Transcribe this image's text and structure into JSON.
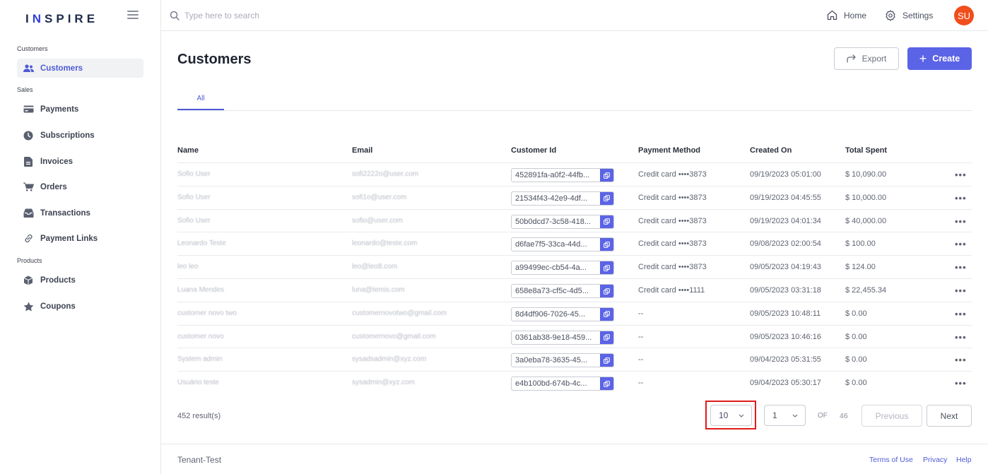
{
  "brand": {
    "name_start": "I",
    "name_accent": "N",
    "name_end": "SPIRE"
  },
  "search": {
    "placeholder": "Type here to search"
  },
  "topbar": {
    "home_label": "Home",
    "settings_label": "Settings",
    "avatar_initials": "SU"
  },
  "sidebar": {
    "sections": [
      "Customers",
      "Sales",
      "Products"
    ],
    "items": [
      {
        "label": "Customers",
        "icon": "users-icon",
        "active": true
      },
      {
        "label": "Payments",
        "icon": "credit-card-icon"
      },
      {
        "label": "Subscriptions",
        "icon": "clock-icon"
      },
      {
        "label": "Invoices",
        "icon": "document-icon"
      },
      {
        "label": "Orders",
        "icon": "cart-icon"
      },
      {
        "label": "Transactions",
        "icon": "inbox-icon"
      },
      {
        "label": "Payment Links",
        "icon": "link-icon"
      },
      {
        "label": "Products",
        "icon": "cube-icon"
      },
      {
        "label": "Coupons",
        "icon": "star-icon"
      }
    ]
  },
  "page": {
    "title": "Customers",
    "export_label": "Export",
    "create_label": "Create",
    "tab_all": "All"
  },
  "table": {
    "headers": [
      "Name",
      "Email",
      "Customer Id",
      "Payment Method",
      "Created On",
      "Total Spent"
    ],
    "rows": [
      {
        "name": "Sofio User",
        "email": "sofi2222o@user.com",
        "id": "452891fa-a0f2-44fb...",
        "method": "Credit card ••••3873",
        "created": "09/19/2023 05:01:00",
        "spent": "$ 10,090.00"
      },
      {
        "name": "Sofio User",
        "email": "sofi1o@user.com",
        "id": "21534f43-42e9-4df...",
        "method": "Credit card ••••3873",
        "created": "09/19/2023 04:45:55",
        "spent": "$ 10,000.00"
      },
      {
        "name": "Sofio User",
        "email": "sofio@user.com",
        "id": "50b0dcd7-3c58-418...",
        "method": "Credit card ••••3873",
        "created": "09/19/2023 04:01:34",
        "spent": "$ 40,000.00"
      },
      {
        "name": "Leonardo Teste",
        "email": "leonardo@teste.com",
        "id": "d6fae7f5-33ca-44d...",
        "method": "Credit card ••••3873",
        "created": "09/08/2023 02:00:54",
        "spent": "$ 100.00"
      },
      {
        "name": "leo leo",
        "email": "leo@leo8.com",
        "id": "a99499ec-cb54-4a...",
        "method": "Credit card ••••3873",
        "created": "09/05/2023 04:19:43",
        "spent": "$ 124.00"
      },
      {
        "name": "Luana Mendes",
        "email": "luna@temis.com",
        "id": "658e8a73-cf5c-4d5...",
        "method": "Credit card ••••1111",
        "created": "09/05/2023 03:31:18",
        "spent": "$ 22,455.34"
      },
      {
        "name": "customer novo two",
        "email": "customernovotwo@gmail.com",
        "id": "8d4df906-7026-45...",
        "method": "--",
        "created": "09/05/2023 10:48:11",
        "spent": "$ 0.00"
      },
      {
        "name": "customer novo",
        "email": "customernovo@gmail.com",
        "id": "0361ab38-9e18-459...",
        "method": "--",
        "created": "09/05/2023 10:46:16",
        "spent": "$ 0.00"
      },
      {
        "name": "System admin",
        "email": "sysadsadmin@xyz.com",
        "id": "3a0eba78-3635-45...",
        "method": "--",
        "created": "09/04/2023 05:31:55",
        "spent": "$ 0.00"
      },
      {
        "name": "Usuário teste",
        "email": "sysadmin@xyz.com",
        "id": "e4b100bd-674b-4c...",
        "method": "--",
        "created": "09/04/2023 05:30:17",
        "spent": "$ 0.00"
      }
    ]
  },
  "pagination": {
    "results": "452 result(s)",
    "page_size": "10",
    "current_page": "1",
    "of_label": "OF",
    "total_pages": "46",
    "previous_label": "Previous",
    "next_label": "Next"
  },
  "footer": {
    "tenant": "Tenant-Test",
    "links": [
      "Terms of Use",
      "Privacy",
      "Help"
    ]
  },
  "colors": {
    "accent": "#5b63e6",
    "avatar": "#f04e1c",
    "highlight": "#e01b1b"
  }
}
